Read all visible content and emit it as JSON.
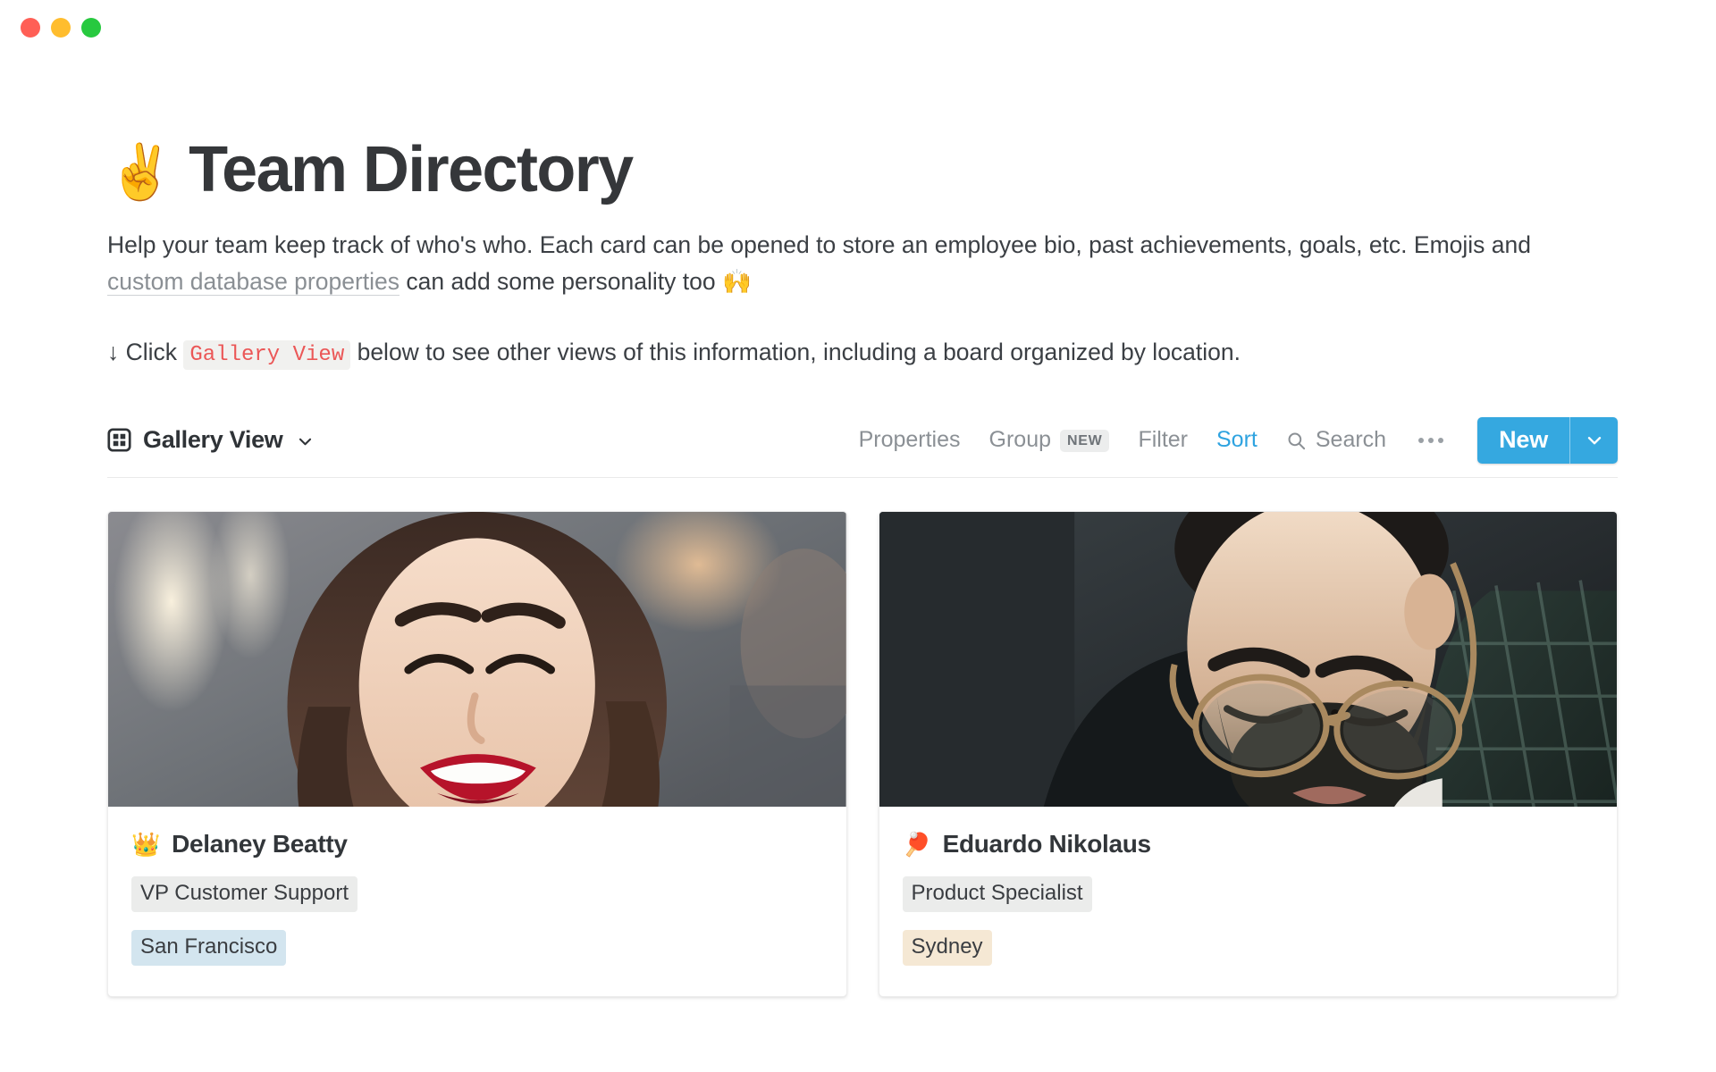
{
  "window": {
    "traffic_lights": [
      {
        "name": "close",
        "color": "#ff5f56"
      },
      {
        "name": "minimize",
        "color": "#ffbd2e"
      },
      {
        "name": "maximize",
        "color": "#27c93f"
      }
    ]
  },
  "page": {
    "title_emoji": "✌️",
    "title": "Team Directory",
    "description": {
      "part1": "Help your team keep track of who's who. Each card can be opened to store an employee bio, past achievements, goals, etc. Emojis and ",
      "link": "custom database properties",
      "part2": " can add some personality too ",
      "end_emoji": "🙌"
    },
    "note": {
      "arrow": "↓",
      "before": " Click ",
      "code": "Gallery View",
      "after": " below to see other views of this information, including a board organized by location."
    }
  },
  "toolbar": {
    "view_icon": "grid-icon",
    "view_label": "Gallery View",
    "view_caret": "chevron-down-icon",
    "items": [
      {
        "label": "Properties",
        "badge": null,
        "accent": false
      },
      {
        "label": "Group",
        "badge": "NEW",
        "accent": false
      },
      {
        "label": "Filter",
        "badge": null,
        "accent": false
      },
      {
        "label": "Sort",
        "badge": null,
        "accent": true
      }
    ],
    "search_label": "Search",
    "search_icon": "search-icon",
    "overflow_icon": "ellipsis-icon",
    "new_label": "New",
    "new_caret": "chevron-down-icon",
    "accent_color": "#2ea3e0",
    "button_color": "#35a8e0"
  },
  "gallery": {
    "cards": [
      {
        "cover_alt": "portrait-laughing-woman",
        "emoji": "👑",
        "name": "Delaney Beatty",
        "role": "VP Customer Support",
        "role_color": "#ebeceb",
        "location": "San Francisco",
        "location_color": "#d3e5ef"
      },
      {
        "cover_alt": "portrait-bearded-man-glasses",
        "emoji": "🏓",
        "name": "Eduardo Nikolaus",
        "role": "Product Specialist",
        "role_color": "#ebeceb",
        "location": "Sydney",
        "location_color": "#f5e8d4"
      }
    ]
  }
}
